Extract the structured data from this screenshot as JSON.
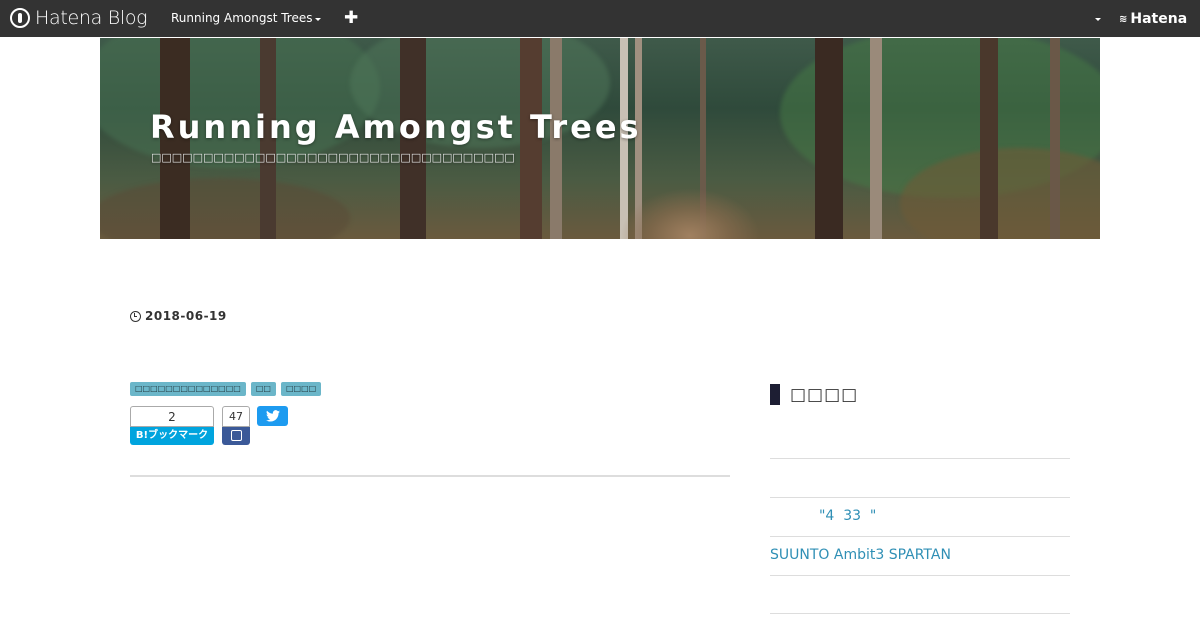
{
  "topbar": {
    "brand": "Hatena Blog",
    "blog_menu_label": "Running Amongst Trees",
    "add_label": "✚",
    "right_brand": "Hatena"
  },
  "header": {
    "title": "Running Amongst Trees",
    "description": "□□□□□□□□□□□□□□□□□□□□□□□□□□□□□□□□□□□"
  },
  "article": {
    "date": "2018-06-19",
    "tags": [
      "□□□□□□□□□□□□□□",
      "□□",
      "□□□□"
    ],
    "share": {
      "hatena_count": "2",
      "hatena_label": "B!ブックマーク",
      "facebook_count": "47"
    }
  },
  "sidebar": {
    "title": "□□□□",
    "links": [
      "",
      "           \"4  33  \"",
      "SUUNTO Ambit3  SPARTAN",
      ""
    ]
  },
  "colors": {
    "topbar_bg": "#333333",
    "tag_bg": "#6bb6c9",
    "hatena_blue": "#00a4de",
    "facebook_blue": "#3b5998",
    "twitter_blue": "#1d9bf0",
    "link_color": "#2f8fb5"
  }
}
